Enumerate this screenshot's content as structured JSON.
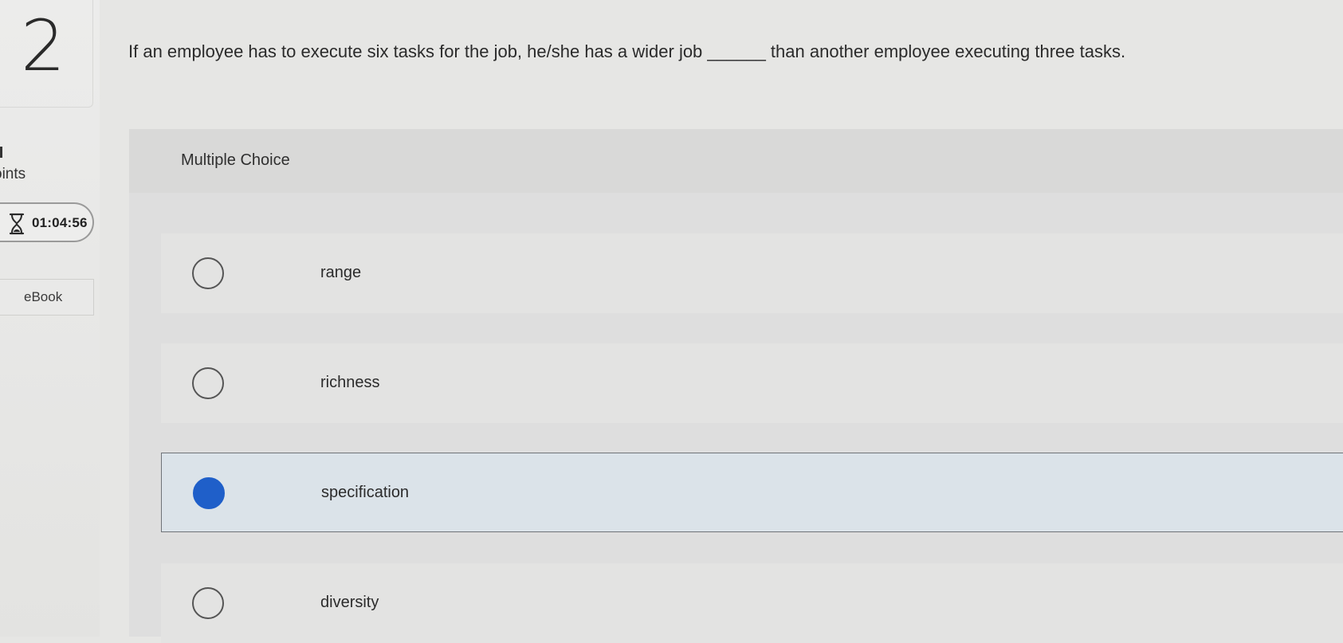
{
  "question": {
    "number": "2",
    "text": "If an employee has to execute six tasks for the job, he/she has a wider job ______ than another employee executing three tasks."
  },
  "sidebar": {
    "points_label": "oints",
    "timer_value": "01:04:56",
    "timer_icon": "hourglass-icon",
    "ebook_label": "eBook"
  },
  "mc": {
    "title": "Multiple Choice",
    "options": [
      {
        "label": "range",
        "selected": false
      },
      {
        "label": "richness",
        "selected": false
      },
      {
        "label": "specification",
        "selected": true
      },
      {
        "label": "diversity",
        "selected": false
      }
    ]
  },
  "colors": {
    "selected_radio": "#1f5fc9",
    "selected_row_bg": "#dbe3e9"
  }
}
